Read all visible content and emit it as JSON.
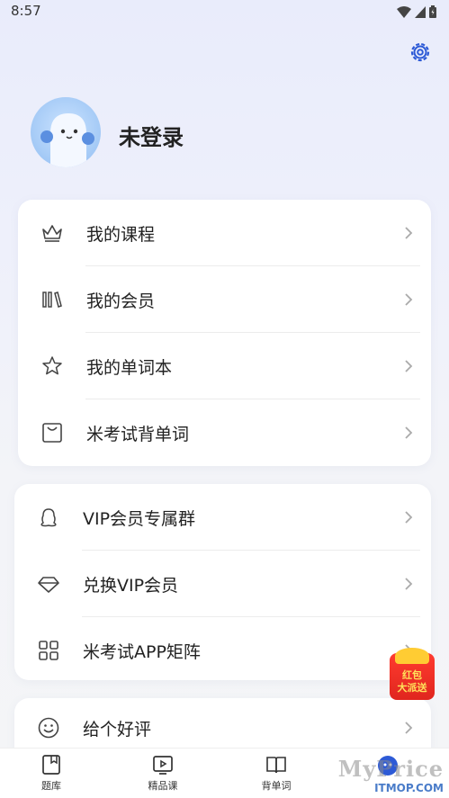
{
  "status_bar": {
    "time": "8:57"
  },
  "profile": {
    "login_label": "未登录"
  },
  "menu_group_1": {
    "items": [
      {
        "label": "我的课程",
        "icon": "crown-icon"
      },
      {
        "label": "我的会员",
        "icon": "books-icon"
      },
      {
        "label": "我的单词本",
        "icon": "star-icon"
      },
      {
        "label": "米考试背单词",
        "icon": "bag-icon"
      }
    ]
  },
  "menu_group_2": {
    "items": [
      {
        "label": "VIP会员专属群",
        "icon": "qq-icon"
      },
      {
        "label": "兑换VIP会员",
        "icon": "diamond-icon"
      },
      {
        "label": "米考试APP矩阵",
        "icon": "grid-icon"
      }
    ]
  },
  "menu_group_3": {
    "items": [
      {
        "label": "给个好评",
        "icon": "smile-icon"
      }
    ]
  },
  "red_packet": {
    "line1": "红包",
    "line2": "大派送"
  },
  "tabbar": {
    "tabs": [
      {
        "label": "题库",
        "icon": "bookmark-book-icon"
      },
      {
        "label": "精品课",
        "icon": "video-play-icon"
      },
      {
        "label": "背单词",
        "icon": "open-book-icon"
      },
      {
        "label": "",
        "icon": "profile-icon"
      }
    ]
  },
  "watermark": {
    "brand": "MyPrice",
    "site": "ITMOP.COM"
  },
  "colors": {
    "accent": "#2d5ad6",
    "red_packet": "#e0261e"
  }
}
